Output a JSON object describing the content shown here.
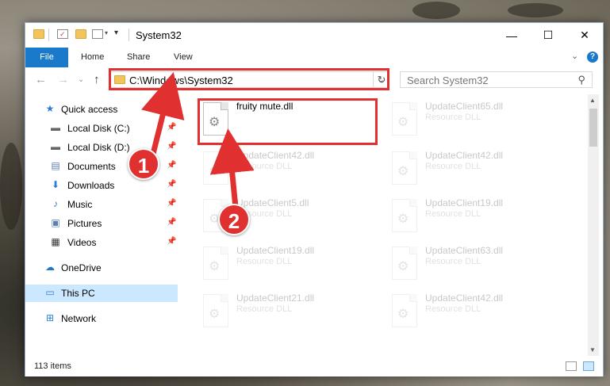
{
  "window": {
    "title": "System32",
    "controls": {
      "minimize": "—",
      "maximize": "☐",
      "close": "✕"
    }
  },
  "ribbon": {
    "tabs": [
      {
        "label": "File"
      },
      {
        "label": "Home"
      },
      {
        "label": "Share"
      },
      {
        "label": "View"
      }
    ]
  },
  "nav": {
    "address": "C:\\Windows\\System32",
    "search_placeholder": "Search System32"
  },
  "sidebar": {
    "items": [
      {
        "label": "Quick access"
      },
      {
        "label": "Local Disk (C:)"
      },
      {
        "label": "Local Disk (D:)"
      },
      {
        "label": "Documents"
      },
      {
        "label": "Downloads"
      },
      {
        "label": "Music"
      },
      {
        "label": "Pictures"
      },
      {
        "label": "Videos"
      },
      {
        "label": "OneDrive"
      },
      {
        "label": "This PC"
      },
      {
        "label": "Network"
      }
    ]
  },
  "files": [
    {
      "name": "fruity mute.dll",
      "type": ""
    },
    {
      "name": "UpdateClient65.dll",
      "type": "Resource DLL"
    },
    {
      "name": "UpdateClient42.dll",
      "type": "Resource DLL"
    },
    {
      "name": "UpdateClient42.dll",
      "type": "Resource DLL"
    },
    {
      "name": "UpdateClient5.dll",
      "type": "Resource DLL"
    },
    {
      "name": "UpdateClient19.dll",
      "type": "Resource DLL"
    },
    {
      "name": "UpdateClient19.dll",
      "type": "Resource DLL"
    },
    {
      "name": "UpdateClient63.dll",
      "type": "Resource DLL"
    },
    {
      "name": "UpdateClient21.dll",
      "type": "Resource DLL"
    },
    {
      "name": "UpdateClient42.dll",
      "type": "Resource DLL"
    }
  ],
  "status": {
    "item_count": "113 items"
  },
  "annotations": {
    "badge1": "1",
    "badge2": "2"
  },
  "colors": {
    "accent": "#1979ca",
    "annotation": "#e03030",
    "selected": "#cce8ff"
  }
}
